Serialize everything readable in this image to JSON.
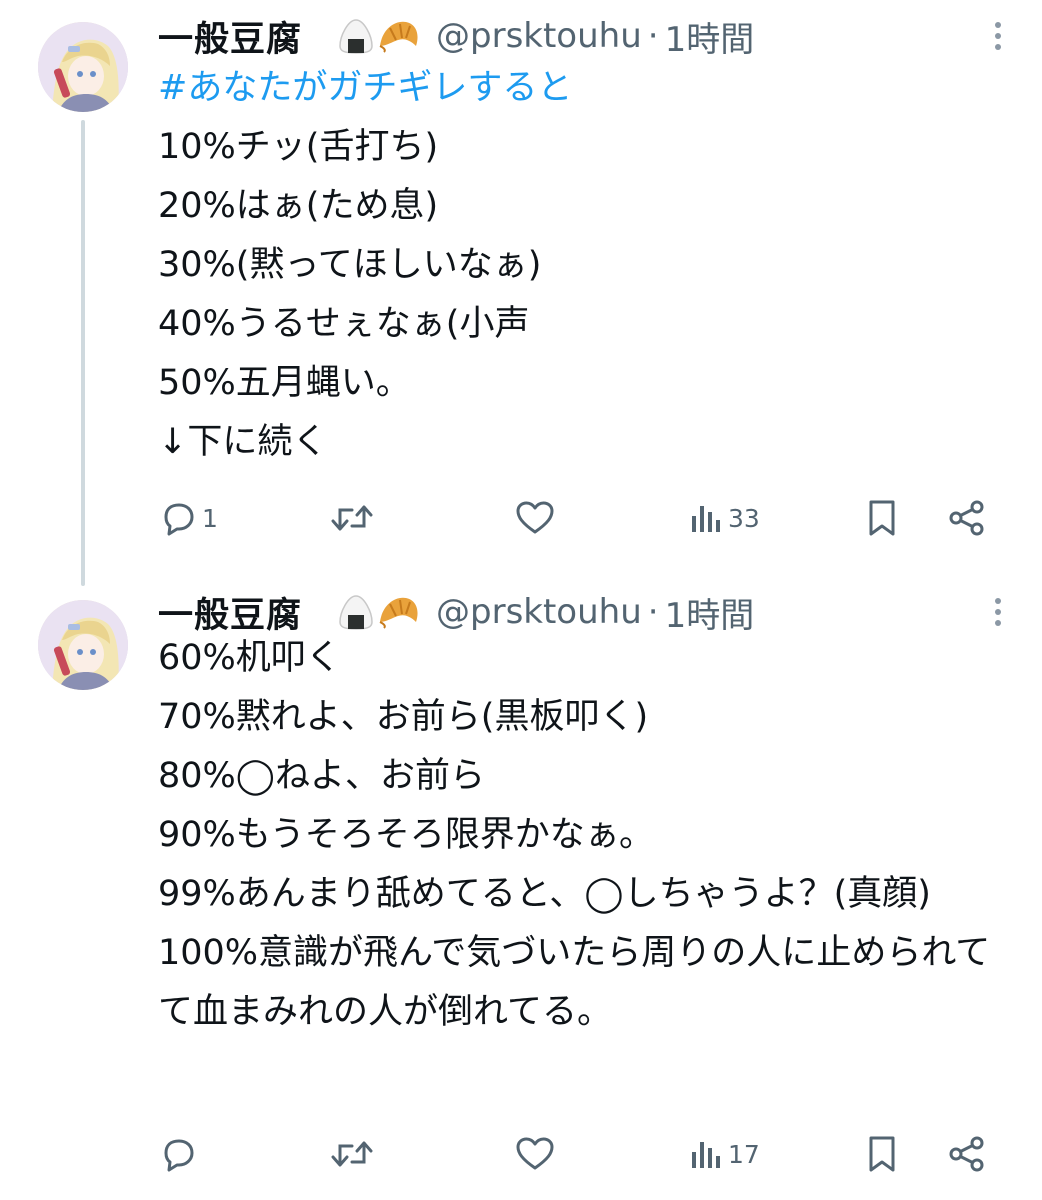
{
  "tweets": [
    {
      "display_name": "一般豆腐",
      "emoji": [
        "🍙",
        "🥐"
      ],
      "handle": "@prsktouhu",
      "separator": "·",
      "time": "1時間",
      "hashtag": "#あなたがガチギレすると",
      "lines": [
        "10%チッ(舌打ち)",
        "20%はぁ(ため息)",
        "30%(黙ってほしいなぁ)",
        "40%うるせぇなぁ(小声",
        "50%五月蝿い。",
        "↓下に続く"
      ],
      "actions": {
        "replies": "1",
        "retweets": "",
        "likes": "",
        "views": "33"
      }
    },
    {
      "display_name": "一般豆腐",
      "emoji": [
        "🍙",
        "🥐"
      ],
      "handle": "@prsktouhu",
      "separator": "·",
      "time": "1時間",
      "lines": [
        "60%机叩く",
        "70%黙れよ、お前ら(黒板叩く)",
        "80%◯ねよ、お前ら",
        "90%もうそろそろ限界かなぁ。",
        "99%あんまり舐めてると、◯しちゃうよ？(真顔)",
        "100%意識が飛んで気づいたら周りの人に止められてて血まみれの人が倒れてる。"
      ],
      "actions": {
        "replies": "",
        "retweets": "",
        "likes": "",
        "views": "17"
      }
    }
  ],
  "colors": {
    "text": "#0f1419",
    "secondary": "#536471",
    "hashtag": "#1d9bf0",
    "thread_line": "#cfd9de"
  },
  "icons": [
    "reply-icon",
    "retweet-icon",
    "like-icon",
    "views-icon",
    "bookmark-icon",
    "share-icon",
    "more-icon"
  ]
}
